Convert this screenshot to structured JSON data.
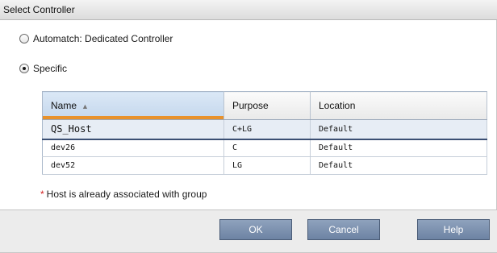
{
  "dialog": {
    "title": "Select Controller"
  },
  "options": {
    "automatch_label": "Automatch: Dedicated Controller",
    "specific_label": "Specific",
    "selected": "specific"
  },
  "grid": {
    "columns": [
      "Name",
      "Purpose",
      "Location"
    ],
    "sort_column": "Name",
    "rows": [
      {
        "name": "QS_Host",
        "purpose": "C+LG",
        "location": "Default"
      },
      {
        "name": "dev26",
        "purpose": "C",
        "location": "Default"
      },
      {
        "name": "dev52",
        "purpose": "LG",
        "location": "Default"
      }
    ],
    "selected_row": 0
  },
  "note": {
    "marker": "*",
    "text": "Host is already associated with group"
  },
  "buttons": {
    "ok": "OK",
    "cancel": "Cancel",
    "help": "Help"
  },
  "icons": {
    "sort": "sort-ascending-icon"
  },
  "colors": {
    "button_bg": "#7a8fae",
    "sort_accent": "#e8912b",
    "required_marker": "#d42020"
  }
}
